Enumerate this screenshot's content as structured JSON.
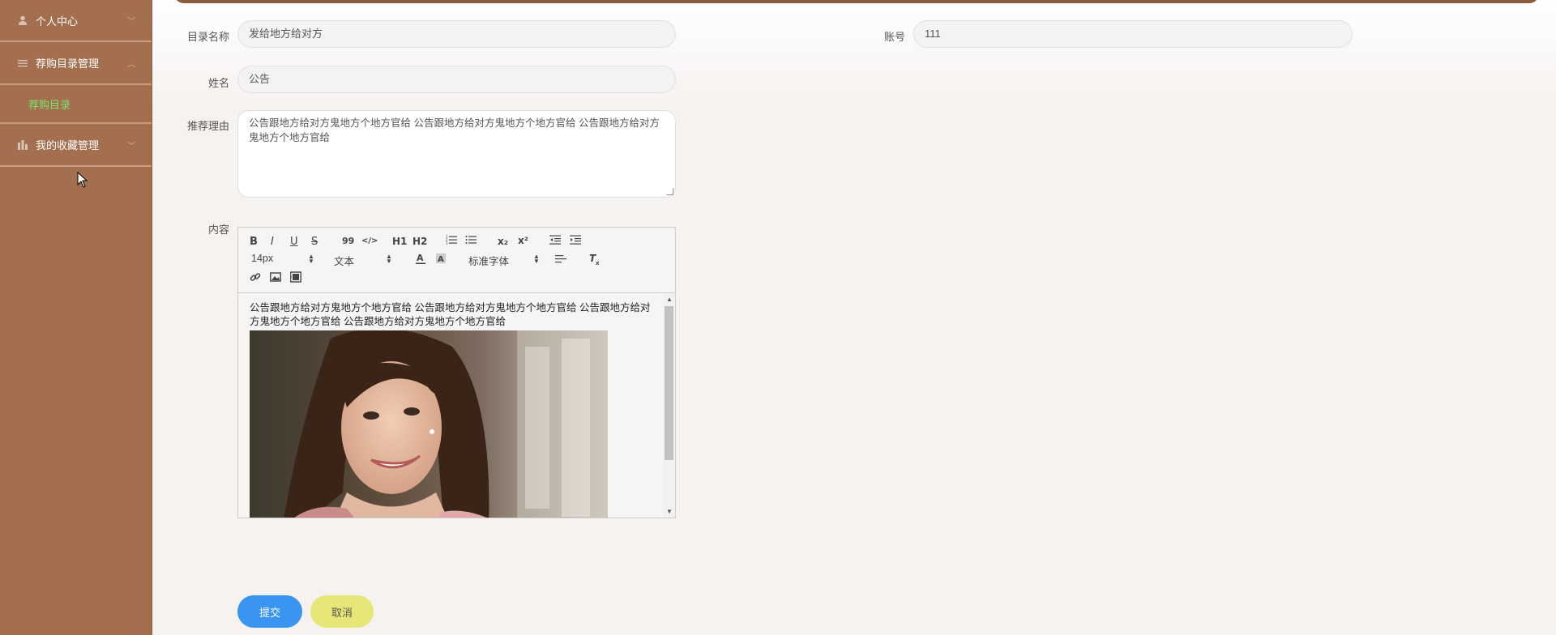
{
  "sidebar": {
    "items": [
      {
        "label": "个人中心",
        "icon": "user-icon"
      },
      {
        "label": "荐购目录管理",
        "icon": "list-icon",
        "children": [
          {
            "label": "荐购目录"
          }
        ]
      },
      {
        "label": "我的收藏管理",
        "icon": "chart-icon"
      }
    ]
  },
  "form": {
    "catalog_name": {
      "label": "目录名称",
      "value": "发给地方给对方"
    },
    "account": {
      "label": "账号",
      "value": "111"
    },
    "name": {
      "label": "姓名",
      "value": "公告"
    },
    "reason": {
      "label": "推荐理由",
      "value": "公告跟地方给对方鬼地方个地方官给    公告跟地方给对方鬼地方个地方官给    公告跟地方给对方鬼地方个地方官给"
    },
    "content": {
      "label": "内容",
      "text": "公告跟地方给对方鬼地方个地方官给  公告跟地方给对方鬼地方个地方官给  公告跟地方给对方鬼地方个地方官给  公告跟地方给对方鬼地方个地方官给"
    }
  },
  "editor": {
    "font_size": "14px",
    "block_type": "文本",
    "font_family": "标准字体",
    "tools": {
      "bold": "B",
      "italic": "I",
      "underline": "U",
      "strike": "S",
      "quote": "99",
      "code": "</>",
      "h1": "H1",
      "h2": "H2",
      "subscript": "x₂",
      "superscript": "x²"
    }
  },
  "buttons": {
    "submit": "提交",
    "cancel": "取消"
  },
  "colors": {
    "sidebar": "#a36f4e",
    "accent_green": "#7be36b",
    "submit": "#3a95f0",
    "cancel": "#e7e778"
  }
}
